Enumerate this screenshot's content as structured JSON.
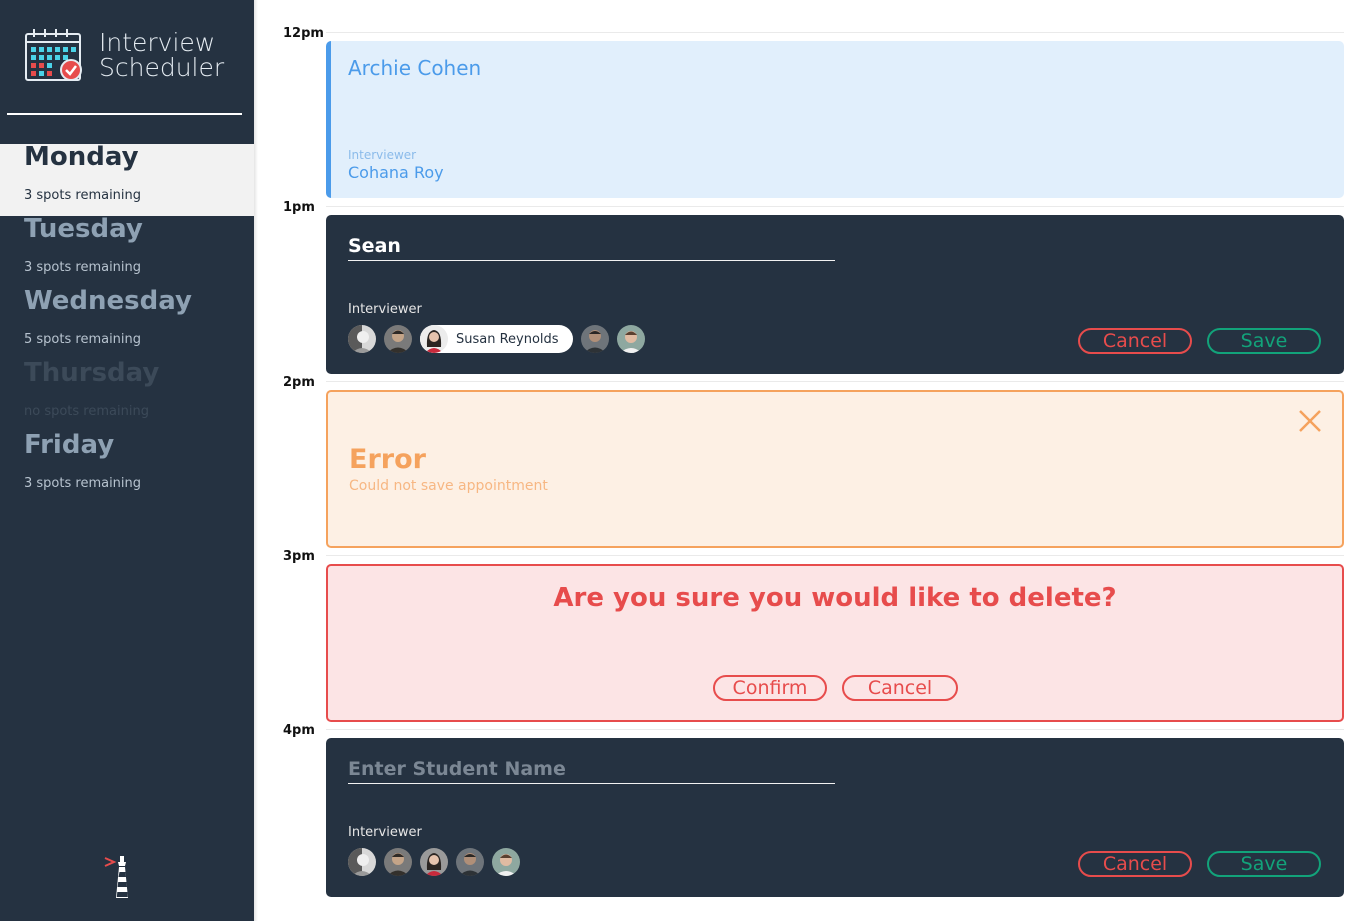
{
  "app": {
    "title_line1": "Interview",
    "title_line2": "Scheduler"
  },
  "days": [
    {
      "name": "Monday",
      "spots": "3 spots remaining",
      "state": "selected"
    },
    {
      "name": "Tuesday",
      "spots": "3 spots remaining",
      "state": "normal"
    },
    {
      "name": "Wednesday",
      "spots": "5 spots remaining",
      "state": "normal"
    },
    {
      "name": "Thursday",
      "spots": "no spots remaining",
      "state": "full"
    },
    {
      "name": "Friday",
      "spots": "3 spots remaining",
      "state": "normal"
    }
  ],
  "schedule": {
    "hours": [
      "12pm",
      "1pm",
      "2pm",
      "3pm",
      "4pm"
    ],
    "show": {
      "student": "Archie Cohen",
      "interviewer_label": "Interviewer",
      "interviewer_name": "Cohana Roy"
    },
    "edit_form": {
      "student_value": "Sean",
      "interviewer_label": "Interviewer",
      "selected_interviewer": "Susan Reynolds",
      "cancel_label": "Cancel",
      "save_label": "Save"
    },
    "error": {
      "title": "Error",
      "message": "Could not save appointment"
    },
    "confirm": {
      "message": "Are you sure you would like to delete?",
      "confirm_label": "Confirm",
      "cancel_label": "Cancel"
    },
    "create_form": {
      "student_placeholder": "Enter Student Name",
      "interviewer_label": "Interviewer",
      "cancel_label": "Cancel",
      "save_label": "Save"
    }
  },
  "colors": {
    "sidebar_bg": "#253241",
    "show_accent": "#4b9bea",
    "error_accent": "#f5a25d",
    "danger": "#e74c4c",
    "save": "#12a37a"
  },
  "icons": [
    "calendar-check-icon",
    "close-icon",
    "lighthouse-icon"
  ]
}
